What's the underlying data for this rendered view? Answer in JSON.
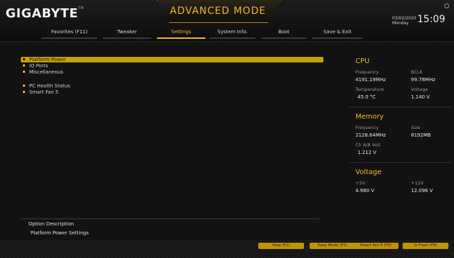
{
  "header": {
    "brand": "GIGABYTE",
    "brand_tm": "TM",
    "mode": "ADVANCED MODE",
    "date": "03/02/2020",
    "day": "Monday",
    "time": "15:09"
  },
  "tabs": [
    {
      "label": "Favorites (F11)"
    },
    {
      "label": "Tweaker"
    },
    {
      "label": "Settings",
      "active": true
    },
    {
      "label": "System Info."
    },
    {
      "label": "Boot"
    },
    {
      "label": "Save & Exit"
    }
  ],
  "menu": [
    {
      "label": "Platform Power",
      "selected": true
    },
    {
      "label": "IO Ports"
    },
    {
      "label": "Miscellaneous"
    },
    {
      "label": "PC Health Status"
    },
    {
      "label": "Smart Fan 5"
    }
  ],
  "cpu": {
    "title": "CPU",
    "freq_label": "Frequency",
    "freq_value": "4191.19MHz",
    "bclk_label": "BCLK",
    "bclk_value": "99.78MHz",
    "temp_label": "Temperature",
    "temp_value": "45.0 °C",
    "volt_label": "Voltage",
    "volt_value": "1.140 V"
  },
  "memory": {
    "title": "Memory",
    "freq_label": "Frequency",
    "freq_value": "2128.64MHz",
    "size_label": "Size",
    "size_value": "8192MB",
    "chvolt_label": "Ch A/B Volt",
    "chvolt_value": "1.212 V"
  },
  "voltage": {
    "title": "Voltage",
    "v5_label": "+5V",
    "v5_value": "4.980 V",
    "v12_label": "+12V",
    "v12_value": "12.096 V"
  },
  "description": {
    "title": "Option Description",
    "text": "Platform Power Settings"
  },
  "footer": [
    {
      "label": "Help (F1)"
    },
    {
      "label": "Easy Mode (F2)"
    },
    {
      "label": "Smart Fan 5 (F6)"
    },
    {
      "label": "Q-Flash (F8)"
    }
  ],
  "colors": {
    "accent": "#f5b82c",
    "highlight": "#c8a000",
    "background": "#121212"
  }
}
